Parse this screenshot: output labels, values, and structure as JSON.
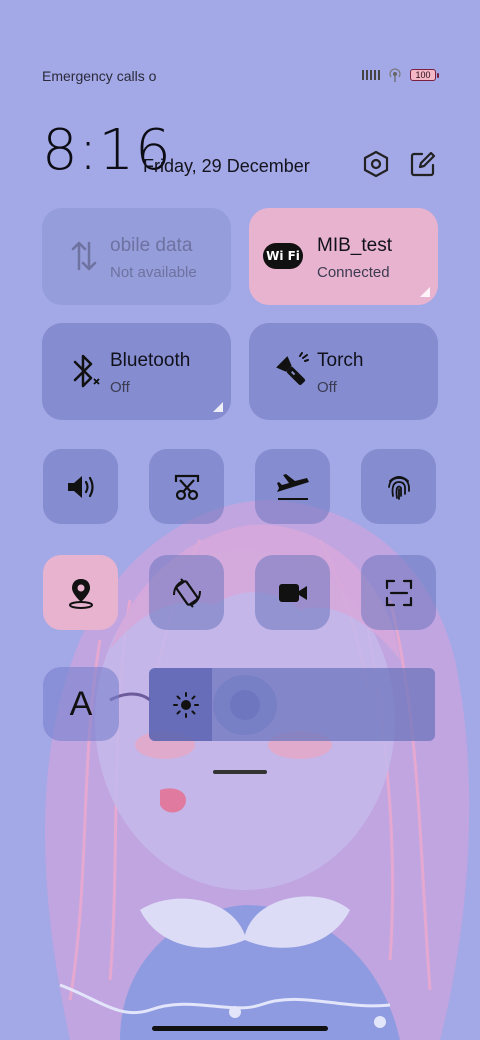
{
  "status_bar": {
    "carrier_text": "Emergency calls o",
    "battery_level": "100"
  },
  "header": {
    "time": "8:16",
    "date": "Friday, 29 December"
  },
  "tiles": {
    "mobile_data": {
      "title": "obile data",
      "subtitle": "Not available",
      "state": "disabled"
    },
    "wifi": {
      "title": "MIB_test",
      "subtitle": "Connected",
      "badge": "Wi Fi",
      "state": "active"
    },
    "bluetooth": {
      "title": "Bluetooth",
      "subtitle": "Off",
      "state": "off"
    },
    "torch": {
      "title": "Torch",
      "subtitle": "Off",
      "state": "off"
    }
  },
  "quick_buttons": [
    {
      "icon": "speaker-icon",
      "active": false
    },
    {
      "icon": "screenshot-crop-icon",
      "active": false
    },
    {
      "icon": "airplane-icon",
      "active": false
    },
    {
      "icon": "fingerprint-icon",
      "active": false
    },
    {
      "icon": "location-icon",
      "active": true
    },
    {
      "icon": "auto-rotate-icon",
      "active": false
    },
    {
      "icon": "screen-record-icon",
      "active": false
    },
    {
      "icon": "scan-icon",
      "active": false
    }
  ],
  "font_button": {
    "label": "A"
  },
  "brightness": {
    "level": 0.22
  },
  "colors": {
    "background": "#a3a8e6",
    "tile": "#6e76be",
    "active_tile": "#e8b3cf",
    "battery_fill": "#f3b7c5"
  }
}
